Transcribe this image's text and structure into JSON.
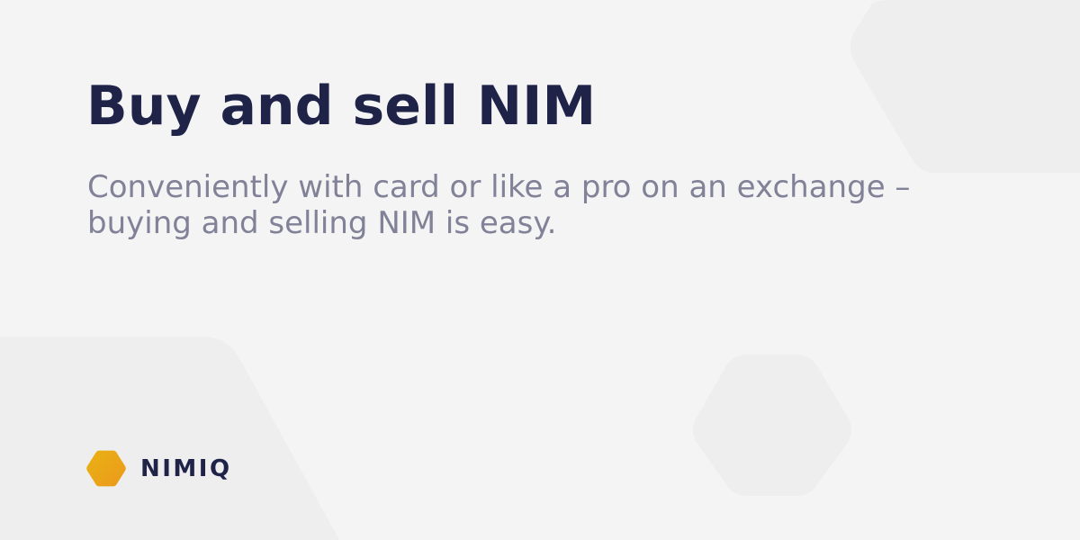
{
  "hero": {
    "title": "Buy and sell NIM",
    "subtitle": "Conveniently with card or like a pro on an exchange – buying and selling NIM is easy."
  },
  "brand": {
    "name": "NIMIQ",
    "logo_icon": "nimiq-hexagon-logo-icon"
  },
  "colors": {
    "background": "#f4f4f5",
    "title": "#1f2348",
    "subtitle": "#818198",
    "logo_gradient_start": "#ec991c",
    "logo_gradient_end": "#e9b213"
  }
}
